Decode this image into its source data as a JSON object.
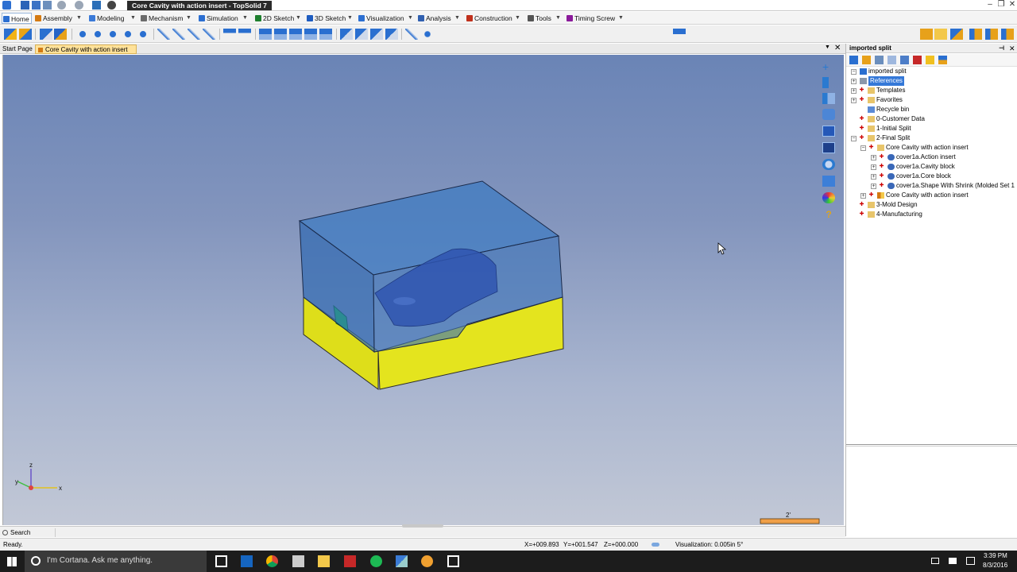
{
  "window": {
    "title": "Core Cavity with action insert - TopSolid 7",
    "controls": [
      "‒",
      "❐",
      "✕"
    ]
  },
  "menu": {
    "tabs": [
      {
        "label": "Home",
        "color": "#2c6fd1"
      },
      {
        "label": "Assembly",
        "color": "#d47a12"
      },
      {
        "label": "Modeling",
        "color": "#3b7ad8"
      },
      {
        "label": "Mechanism",
        "color": "#6c6c6c"
      },
      {
        "label": "Simulation",
        "color": "#2c6fd1"
      },
      {
        "label": "2D Sketch",
        "color": "#1e7f2e"
      },
      {
        "label": "3D Sketch",
        "color": "#1e5cc0"
      },
      {
        "label": "Visualization",
        "color": "#2c6fd1"
      },
      {
        "label": "Analysis",
        "color": "#3060b0"
      },
      {
        "label": "Construction",
        "color": "#c0301c"
      },
      {
        "label": "Tools",
        "color": "#555555"
      },
      {
        "label": "Timing Screw",
        "color": "#8a1a9a"
      }
    ],
    "dropdown_glyph": "▼"
  },
  "doc_tabs": {
    "start": "Start Page",
    "active": "Core Cavity with action insert",
    "close_glyph": "✕",
    "menu_glyph": "▼"
  },
  "viewport": {
    "axis_labels": {
      "z": "z",
      "y": "y",
      "x": "x"
    },
    "scale_label": "2'",
    "colors": {
      "cavity_front": "#2f68b0",
      "cavity_top": "#3f7bc2",
      "core_block": "#dede1a",
      "action_insert": "#23e04a",
      "part": "#2f55b0"
    }
  },
  "panel": {
    "title": "imported split",
    "pin_glyph": "⊣",
    "close_glyph": "✕",
    "tree": [
      {
        "label": "imported split",
        "level": 0,
        "icon": "document-icon"
      },
      {
        "label": "References",
        "level": 1,
        "icon": "references-icon",
        "selected": true
      },
      {
        "label": "Templates",
        "level": 1,
        "icon": "folder-icon"
      },
      {
        "label": "Favorites",
        "level": 1,
        "icon": "folder-icon"
      },
      {
        "label": "Recycle bin",
        "level": 1,
        "icon": "recycle-icon"
      },
      {
        "label": "0-Customer Data",
        "level": 1,
        "icon": "folder-icon"
      },
      {
        "label": "1-Initial Split",
        "level": 1,
        "icon": "folder-icon"
      },
      {
        "label": "2-Final Split",
        "level": 1,
        "icon": "folder-icon"
      },
      {
        "label": "Core Cavity with action insert",
        "level": 2,
        "icon": "folder-icon"
      },
      {
        "label": "cover1a.Action insert",
        "level": 3,
        "icon": "part-icon"
      },
      {
        "label": "cover1a.Cavity block",
        "level": 3,
        "icon": "part-icon"
      },
      {
        "label": "cover1a.Core block",
        "level": 3,
        "icon": "part-icon"
      },
      {
        "label": "cover1a.Shape With Shrink (Molded Set 1",
        "level": 3,
        "icon": "part-icon"
      },
      {
        "label": "Core Cavity with action insert",
        "level": 2,
        "icon": "assembly-icon"
      },
      {
        "label": "3-Mold Design",
        "level": 1,
        "icon": "folder-icon"
      },
      {
        "label": "4-Manufacturing",
        "level": 1,
        "icon": "folder-icon"
      }
    ]
  },
  "search": {
    "label": "Search"
  },
  "status": {
    "ready": "Ready.",
    "x": "X=+009.893",
    "y": "Y=+001.547",
    "z": "Z=+000.000",
    "visualization": "Visualization: 0.005in 5°"
  },
  "taskbar": {
    "cortana_placeholder": "I'm Cortana. Ask me anything.",
    "time": "3:39 PM",
    "date": "8/3/2016"
  }
}
